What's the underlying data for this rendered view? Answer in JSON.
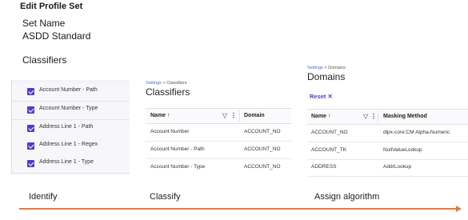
{
  "page": {
    "heading": "Edit Profile Set",
    "set_name_label": "Set Name",
    "set_name_value": "ASDD Standard",
    "classifiers_label": "Classifiers"
  },
  "identify_panel": {
    "items": [
      {
        "label": "Account Number - Path",
        "checked": true
      },
      {
        "label": "Account Number - Type",
        "checked": true
      },
      {
        "label": "Address Line 1 - Path",
        "checked": true
      },
      {
        "label": "Address Line 1 - Regex",
        "checked": true
      },
      {
        "label": "Address Line 1 - Type",
        "checked": true
      }
    ]
  },
  "classify_panel": {
    "breadcrumb": {
      "parent": "Settings",
      "separator": ">",
      "current": "Classifiers"
    },
    "title": "Classifiers",
    "columns": {
      "name": "Name",
      "domain": "Domain"
    },
    "sort_icon": "arrow-up-icon",
    "rows": [
      {
        "name": "Account Number",
        "domain": "ACCOUNT_NO"
      },
      {
        "name": "Account Number - Path",
        "domain": "ACCOUNT_NO"
      },
      {
        "name": "Account Number - Type",
        "domain": "ACCOUNT_NO"
      }
    ]
  },
  "assign_panel": {
    "breadcrumb": {
      "parent": "Settings",
      "separator": ">",
      "current": "Domains"
    },
    "title": "Domains",
    "reset_label": "Reset",
    "reset_icon": "✕",
    "columns": {
      "name": "Name",
      "masking_method": "Masking Method"
    },
    "rows": [
      {
        "name": "ACCOUNT_NO",
        "masking_method": "dlpx-core:CM Alpha-Numeric"
      },
      {
        "name": "ACCOUNT_TK",
        "masking_method": "NullValueLookup"
      },
      {
        "name": "ADDRESS",
        "masking_method": "AddrLookup"
      }
    ]
  },
  "steps": {
    "identify": "Identify",
    "classify": "Classify",
    "assign": "Assign algorithm"
  },
  "colors": {
    "accent": "#4a3ec9",
    "arrow": "#e8793a"
  }
}
